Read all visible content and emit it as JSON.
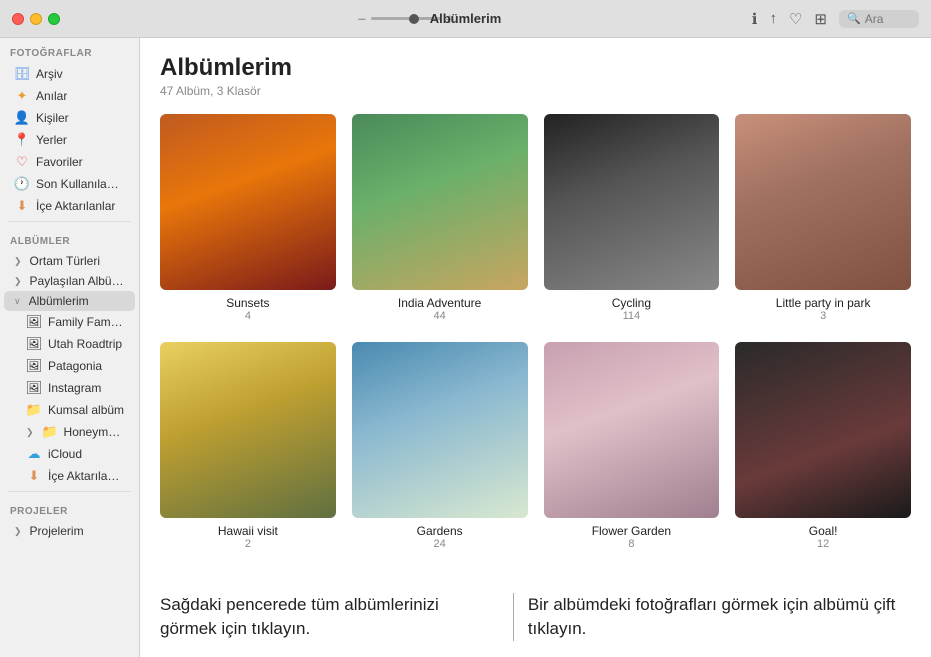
{
  "titlebar": {
    "title": "Albümlerim",
    "search_placeholder": "Ara"
  },
  "sidebar": {
    "section_photos": "Fotoğraflar",
    "section_albums": "Albümler",
    "section_projects": "Projeler",
    "items_photos": [
      {
        "id": "archive",
        "label": "Arşiv",
        "icon": "🗄",
        "color": "#5a9ae8"
      },
      {
        "id": "memories",
        "label": "Anılar",
        "icon": "✦",
        "color": "#e8a030"
      },
      {
        "id": "people",
        "label": "Kişiler",
        "icon": "👤",
        "color": "#e06050"
      },
      {
        "id": "places",
        "label": "Yerler",
        "icon": "📍",
        "color": "#50b050"
      },
      {
        "id": "favorites",
        "label": "Favoriler",
        "icon": "♡",
        "color": "#e84040"
      },
      {
        "id": "recent",
        "label": "Son Kullanılanlar",
        "icon": "🕐",
        "color": "#50a0e8"
      },
      {
        "id": "import",
        "label": "İçe Aktarılanlar",
        "icon": "⬇",
        "color": "#e09050"
      }
    ],
    "items_albums": [
      {
        "id": "nature-types",
        "label": "Ortam Türleri",
        "icon": "❯",
        "indent": 0
      },
      {
        "id": "shared-albums",
        "label": "Paylaşılan Albümler",
        "icon": "❯",
        "indent": 0
      },
      {
        "id": "my-albums",
        "label": "Albümlerim",
        "icon": "∨",
        "indent": 0,
        "active": true
      },
      {
        "id": "family-family",
        "label": "Family Family…",
        "icon": "🖼",
        "indent": 1
      },
      {
        "id": "utah-roadtrip",
        "label": "Utah Roadtrip",
        "icon": "🖼",
        "indent": 1
      },
      {
        "id": "patagonia",
        "label": "Patagonia",
        "icon": "🖼",
        "indent": 1
      },
      {
        "id": "instagram",
        "label": "Instagram",
        "icon": "🖼",
        "indent": 1
      },
      {
        "id": "beach-album",
        "label": "Kumsal albüm",
        "icon": "📁",
        "indent": 1
      },
      {
        "id": "honeymoon",
        "label": "Honeymoon",
        "icon": "❯📁",
        "indent": 1
      },
      {
        "id": "icloud",
        "label": "iCloud",
        "icon": "☁",
        "indent": 1
      },
      {
        "id": "imported",
        "label": "İçe Aktarılanlar",
        "icon": "⬇",
        "indent": 1
      }
    ],
    "items_projects": [
      {
        "id": "projects",
        "label": "Projelerim",
        "icon": "❯",
        "indent": 0
      }
    ]
  },
  "content": {
    "title": "Albümlerim",
    "subtitle": "47 Albüm, 3 Klasör",
    "albums": [
      {
        "id": "sunsets",
        "name": "Sunsets",
        "count": "4",
        "color_class": "sunsets-img"
      },
      {
        "id": "india",
        "name": "India Adventure",
        "count": "44",
        "color_class": "india-img"
      },
      {
        "id": "cycling",
        "name": "Cycling",
        "count": "114",
        "color_class": "cycling-img"
      },
      {
        "id": "party",
        "name": "Little party in park",
        "count": "3",
        "color_class": "party-img"
      },
      {
        "id": "hawaii",
        "name": "Hawaii visit",
        "count": "2",
        "color_class": "hawaii-img"
      },
      {
        "id": "gardens",
        "name": "Gardens",
        "count": "24",
        "color_class": "gardens-img"
      },
      {
        "id": "flower",
        "name": "Flower Garden",
        "count": "8",
        "color_class": "flower-img"
      },
      {
        "id": "goal",
        "name": "Goal!",
        "count": "12",
        "color_class": "goal-img"
      }
    ]
  },
  "annotations": {
    "left": "Sağdaki pencerede tüm albümlerinizi görmek için tıklayın.",
    "right": "Bir albümdeki fotoğrafları görmek için albümü çift tıklayın."
  }
}
